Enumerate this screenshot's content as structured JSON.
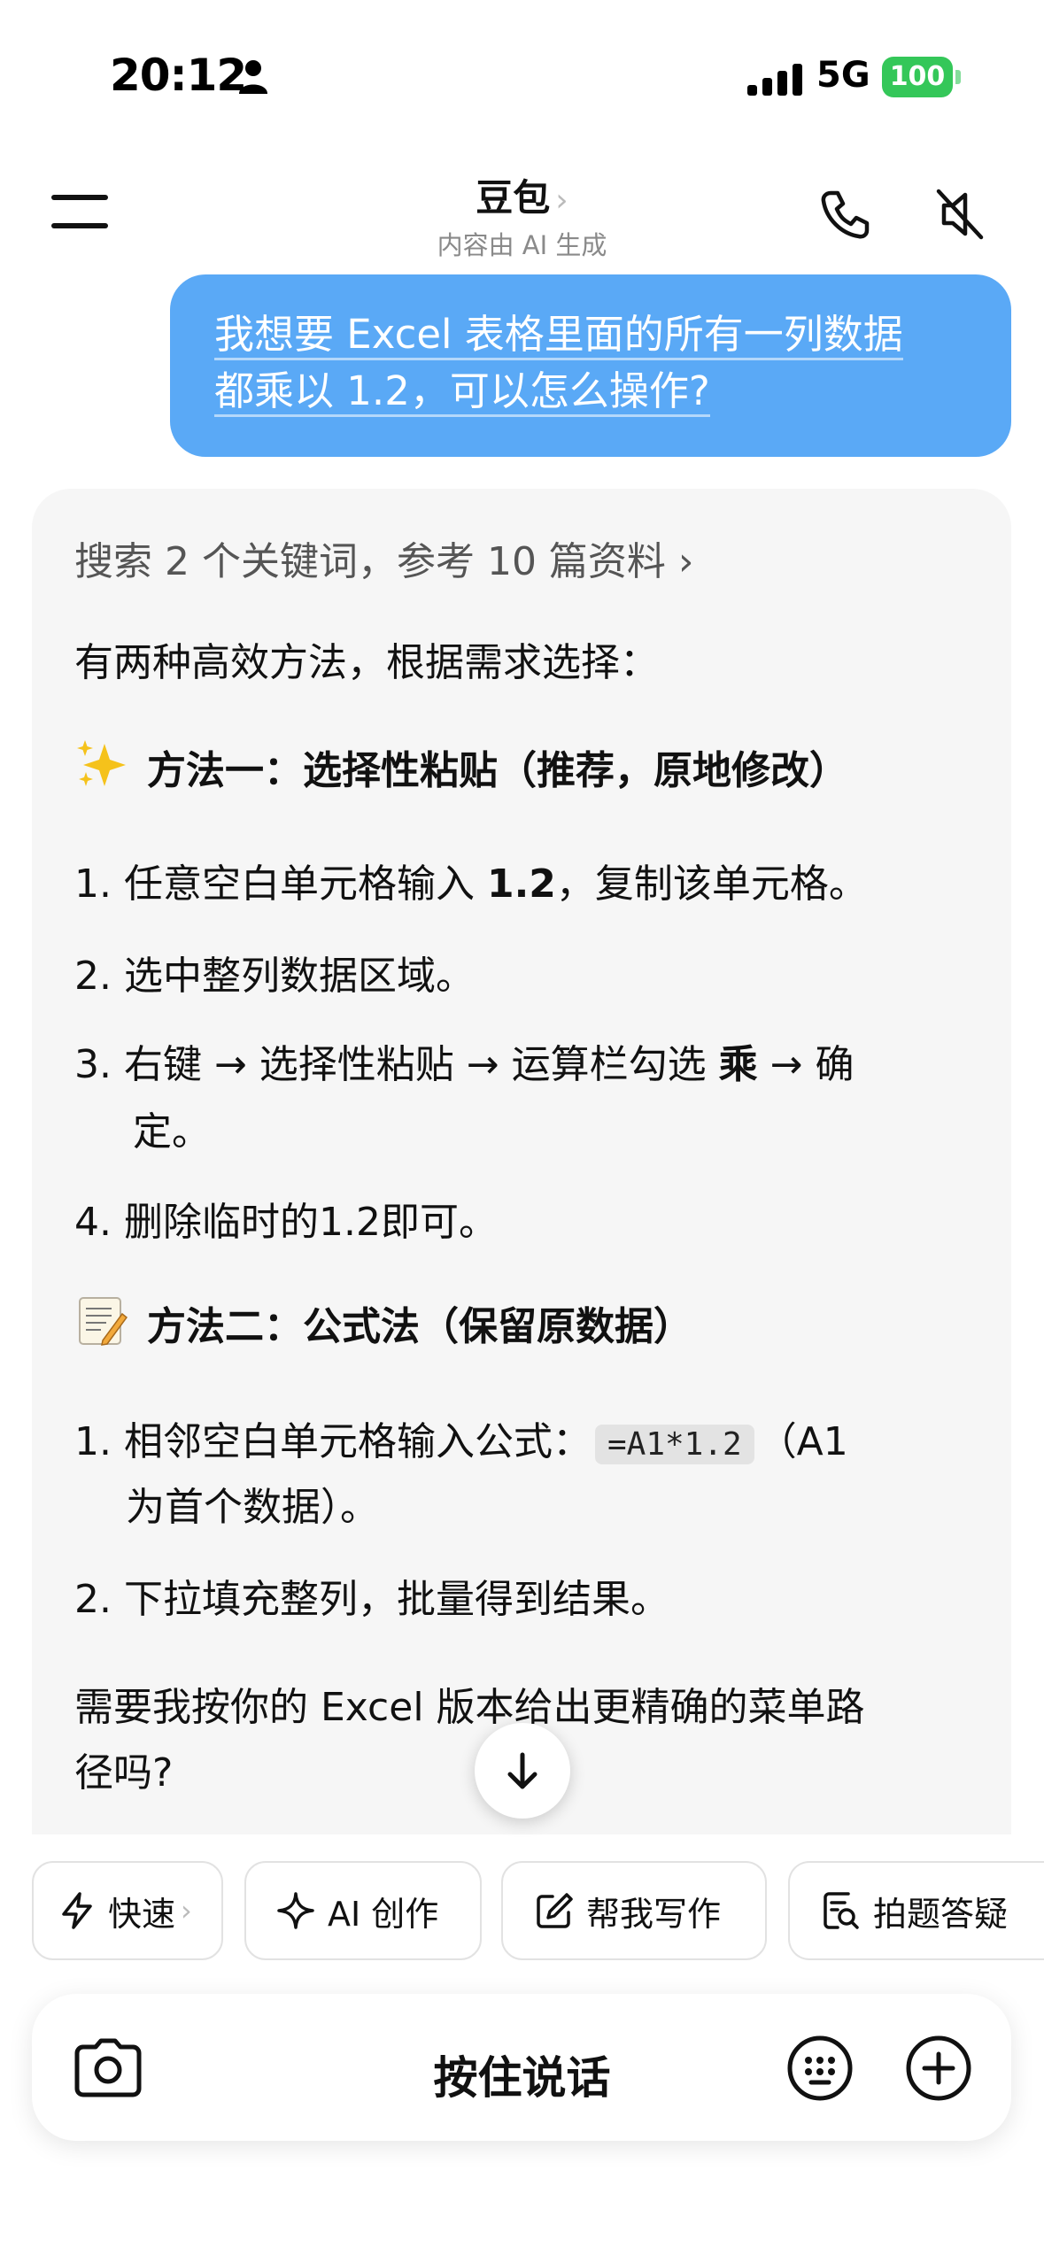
{
  "status_bar": {
    "time": "20:12",
    "network": "5G",
    "battery": "100"
  },
  "header": {
    "title": "豆包",
    "title_chevron": "›",
    "subtitle": "内容由 AI 生成"
  },
  "user_message": {
    "line1": "我想要 Excel 表格里面的所有一列数据",
    "line2": "都乘以 1.2，可以怎么操作?"
  },
  "assistant": {
    "reference": "搜索 2 个关键词，参考 10 篇资料 ›",
    "intro": "有两种高效方法，根据需求选择：",
    "method1": {
      "title": "方法一：选择性粘贴（推荐，原地修改）",
      "step1_pre": "1. 任意空白单元格输入 ",
      "step1_bold": "1.2",
      "step1_post": "，复制该单元格。",
      "step2": "2. 选中整列数据区域。",
      "step3_pre": "3. 右键 → 选择性粘贴 → 运算栏勾选 ",
      "step3_bold": "乘",
      "step3_post": " → 确",
      "step3_cont": "定。",
      "step4": "4. 删除临时的1.2即可。"
    },
    "method2": {
      "title": "方法二：公式法（保留原数据）",
      "step1_pre": "1. 相邻空白单元格输入公式：",
      "step1_code": "=A1*1.2",
      "step1_post": "（A1",
      "step1_cont": "为首个数据）。",
      "step2": "2. 下拉填充整列，批量得到结果。"
    },
    "closing_line1": "需要我按你的 Excel 版本给出更精确的菜单路",
    "closing_line2": "径吗?"
  },
  "chips": [
    {
      "label": "快速",
      "icon": "lightning-icon"
    },
    {
      "label": "AI 创作",
      "icon": "sparkle-icon"
    },
    {
      "label": "帮我写作",
      "icon": "edit-icon"
    },
    {
      "label": "拍题答疑",
      "icon": "photo-search-icon"
    }
  ],
  "chip_chevron": "›",
  "input_bar": {
    "hold_to_talk": "按住说话"
  },
  "colors": {
    "bubble": "#5aa9f6",
    "card": "#f6f6f6",
    "battery": "#34c759"
  }
}
